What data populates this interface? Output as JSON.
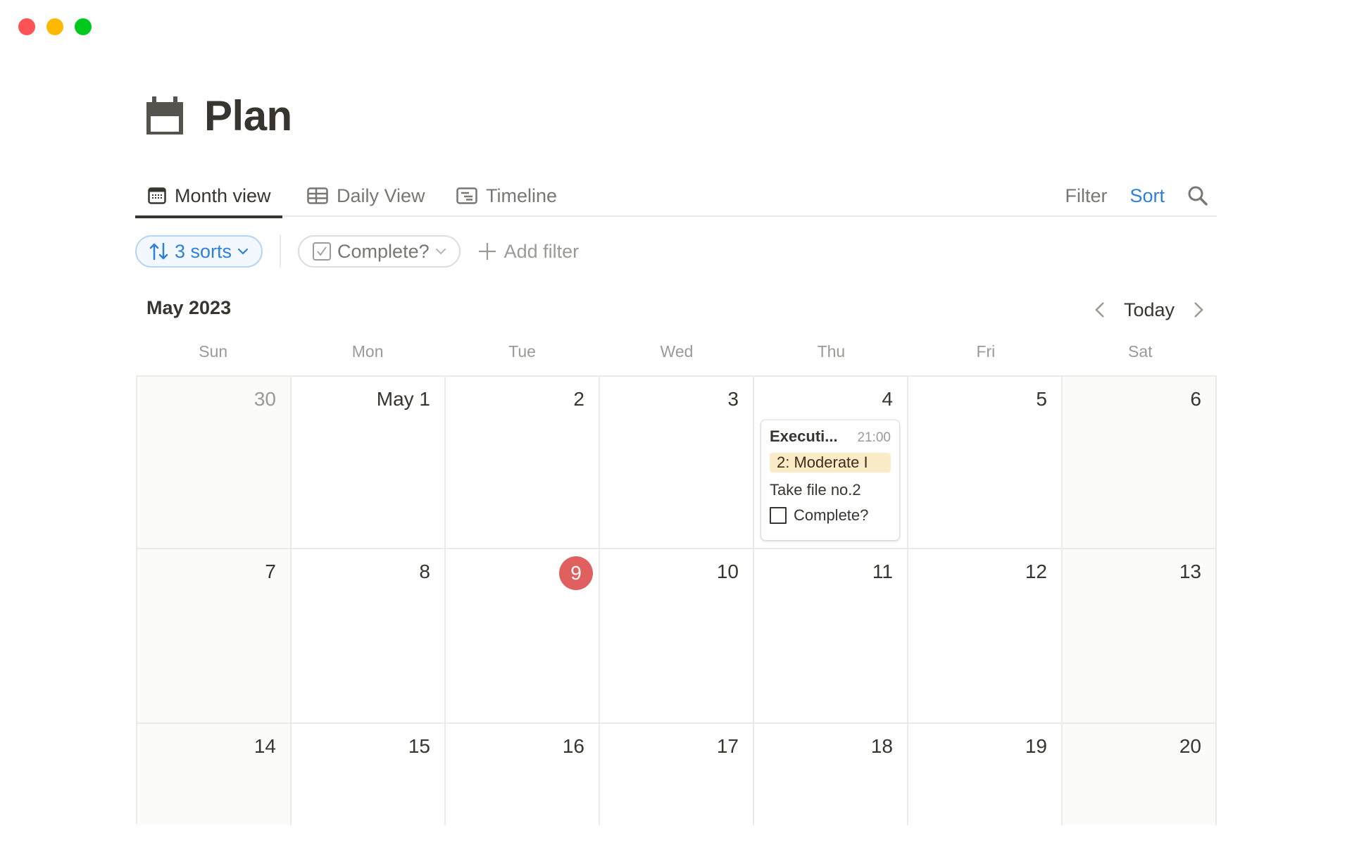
{
  "window": {
    "traffic_lights": [
      {
        "name": "close",
        "color": "#ff5257"
      },
      {
        "name": "minimize",
        "color": "#ffb800"
      },
      {
        "name": "zoom",
        "color": "#00c91e"
      }
    ]
  },
  "page": {
    "icon": "calendar-icon",
    "title": "Plan"
  },
  "tabs": [
    {
      "label": "Month view",
      "icon": "calendar-grid-icon",
      "active": true
    },
    {
      "label": "Daily View",
      "icon": "table-icon",
      "active": false
    },
    {
      "label": "Timeline",
      "icon": "timeline-icon",
      "active": false
    }
  ],
  "tab_actions": {
    "filter_label": "Filter",
    "sort_label": "Sort",
    "search_icon": "search-icon"
  },
  "toolbar": {
    "sorts_label": "3 sorts",
    "complete_filter_label": "Complete?",
    "add_filter_label": "Add filter"
  },
  "calendar": {
    "month_label": "May 2023",
    "today_label": "Today",
    "weekdays": [
      "Sun",
      "Mon",
      "Tue",
      "Wed",
      "Thu",
      "Fri",
      "Sat"
    ],
    "weeks": [
      [
        {
          "label": "30",
          "muted": true
        },
        {
          "label": "May 1"
        },
        {
          "label": "2"
        },
        {
          "label": "3"
        },
        {
          "label": "4"
        },
        {
          "label": "5"
        },
        {
          "label": "6"
        }
      ],
      [
        {
          "label": "7"
        },
        {
          "label": "8"
        },
        {
          "label": "9",
          "today": true
        },
        {
          "label": "10"
        },
        {
          "label": "11"
        },
        {
          "label": "12"
        },
        {
          "label": "13"
        }
      ],
      [
        {
          "label": "14"
        },
        {
          "label": "15"
        },
        {
          "label": "16"
        },
        {
          "label": "17"
        },
        {
          "label": "18"
        },
        {
          "label": "19"
        },
        {
          "label": "20"
        }
      ]
    ],
    "today_color": "#e06060",
    "event": {
      "week": 0,
      "day": 4,
      "title": "Executi...",
      "time": "21:00",
      "tag": "2: Moderate I",
      "tag_color": "#fbecc8",
      "note": "Take file no.2",
      "checkbox_label": "Complete?",
      "checked": false
    }
  }
}
